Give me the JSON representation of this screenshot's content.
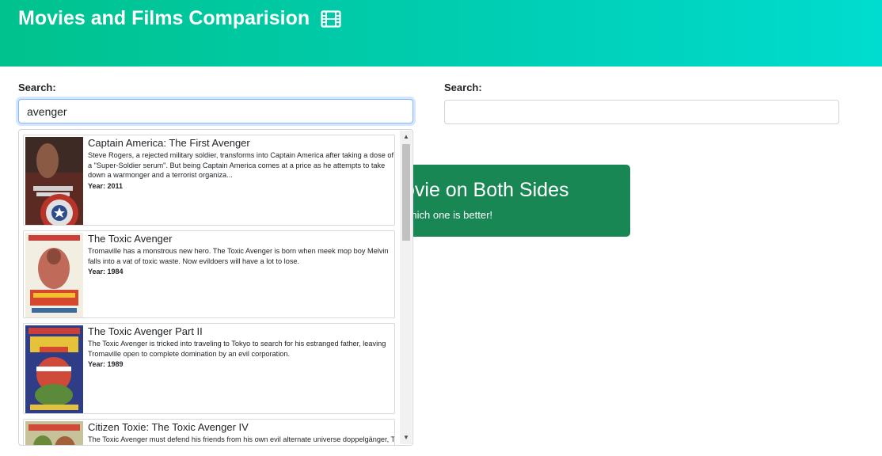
{
  "header": {
    "title": "Movies and Films Comparision",
    "icon": "film-icon",
    "gradient_colors": [
      "#00c28d",
      "#00dccf"
    ]
  },
  "left_search": {
    "label": "Search:",
    "value": "avenger"
  },
  "right_search": {
    "label": "Search:",
    "value": ""
  },
  "banner": {
    "title": "ovie on Both Sides",
    "subtitle": "which one is better!",
    "color": "#198754"
  },
  "results": [
    {
      "title": "Captain America: The First Avenger",
      "plot": "Steve Rogers, a rejected military soldier, transforms into Captain America after taking a dose of a \"Super-Soldier serum\". But being Captain America comes at a price as he attempts to take down a warmonger and a terrorist organiza...",
      "year": "Year: 2011"
    },
    {
      "title": "The Toxic Avenger",
      "plot": "Tromaville has a monstrous new hero. The Toxic Avenger is born when meek mop boy Melvin falls into a vat of toxic waste. Now evildoers will have a lot to lose.",
      "year": "Year: 1984"
    },
    {
      "title": "The Toxic Avenger Part II",
      "plot": "The Toxic Avenger is tricked into traveling to Tokyo to search for his estranged father, leaving Tromaville open to complete domination by an evil corporation.",
      "year": "Year: 1989"
    },
    {
      "title": "Citizen Toxie: The Toxic Avenger IV",
      "plot": "The Toxic Avenger must defend his friends from his own evil alternate universe doppelgänger, The",
      "year": ""
    }
  ]
}
